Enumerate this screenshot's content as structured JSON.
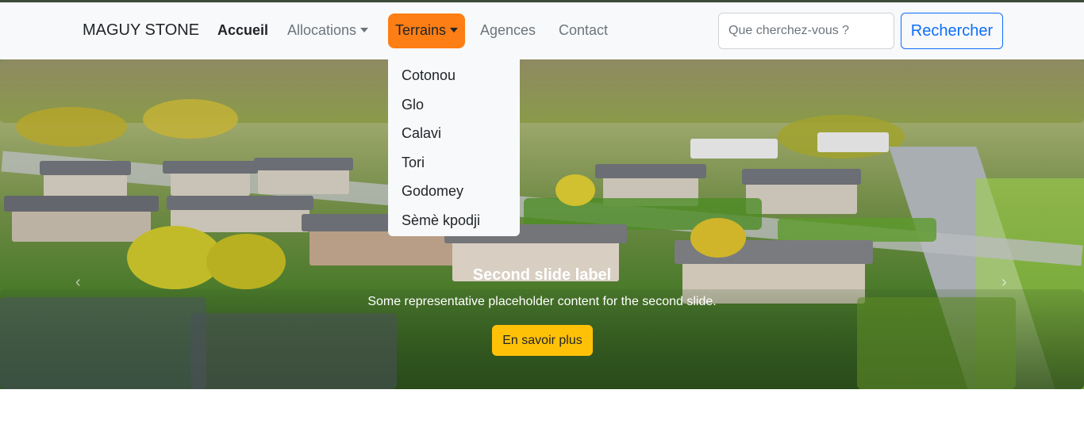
{
  "navbar": {
    "brand": "MAGUY STONE",
    "links": [
      {
        "label": "Accueil"
      },
      {
        "label": "Allocations"
      },
      {
        "label": "Terrains"
      },
      {
        "label": "Agences"
      },
      {
        "label": "Contact"
      }
    ],
    "search": {
      "placeholder": "Que cherchez-vous ?",
      "value": "",
      "button": "Rechercher"
    },
    "accent": "#fd7e14"
  },
  "dropdown": {
    "items": [
      "Cotonou",
      "Glo",
      "Calavi",
      "Tori",
      "Godomey",
      "Sèmè kpodji"
    ]
  },
  "carousel": {
    "caption_title": "Second slide label",
    "caption_text": "Some representative placeholder content for the second slide.",
    "button": "En savoir plus",
    "prev_icon": "‹",
    "next_icon": "›"
  }
}
